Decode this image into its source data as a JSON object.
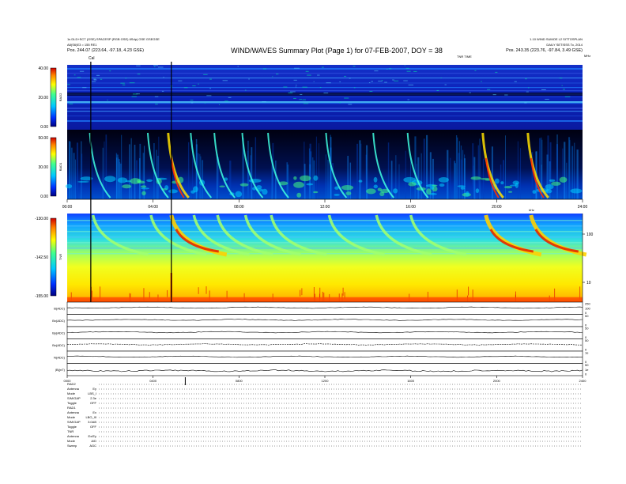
{
  "chart_data": {
    "type": "heatmap",
    "title": "WIND/WAVES Summary Plot (Page 1) for 07-FEB-2007, DOY = 38",
    "header_left": [
      "1s DLD+SCT (GSE) SPACESP (RGB GSE) 6Sdp)  GSE GSEGSE",
      "A8(S6)E3 = 155 RE1",
      "Pos.  244.07 (223.64, -97.18, 4.23 GSE)"
    ],
    "header_right": [
      "1.10 WIND SUMOE                    L2 SITTOSPLAN",
      "DAILY SETISSS To, 2014",
      "Pos.  243.35 (223.76, -97.84, 3.49 GSE)"
    ],
    "marker_labels": [
      "Cal",
      "TNR TIME"
    ],
    "time_ticks": [
      "00:00",
      "04:00",
      "08:00",
      "12:00",
      "16:00",
      "20:00",
      "24:00"
    ],
    "bottom_time_ticks": [
      "0000",
      "0400",
      "0800",
      "1200",
      "1600",
      "2000",
      "2400"
    ],
    "panels": [
      {
        "name": "RAD2",
        "ylim": [
          0,
          40
        ],
        "colorbar_ticks": [
          "40.00",
          "20.00",
          "0.00"
        ],
        "right_unit": "MHz"
      },
      {
        "name": "RAD1",
        "ylim": [
          0,
          50
        ],
        "colorbar_ticks": [
          "50.00",
          "30.00",
          "0.00"
        ],
        "right_unit": ""
      },
      {
        "name": "TNR",
        "ylim": [
          -155,
          -130
        ],
        "colorbar_ticks": [
          "-130.00",
          "-142.50",
          "-155.00"
        ],
        "right_ticks": [
          "100",
          "10"
        ],
        "right_unit": "kHz"
      }
    ],
    "bursts_hours": [
      1.2,
      3.9,
      4.85,
      5.9,
      7.0,
      8.3,
      9.5,
      12.2,
      14.4,
      16.0,
      19.5,
      21.6
    ],
    "strong_burst_hours": [
      4.85,
      19.5,
      21.6
    ],
    "gaps_hours": [
      1.1,
      4.85
    ],
    "line_panels": [
      {
        "label": "B(ADC)",
        "ticks": [
          "250",
          "100",
          "0"
        ]
      },
      {
        "label": "Bx(ADC)",
        "ticks": [
          "50",
          "0"
        ]
      },
      {
        "label": "By(ADC)",
        "ticks": [
          "50",
          "0"
        ]
      },
      {
        "label": "Bz(ADC)",
        "ticks": [
          "50",
          "0"
        ]
      },
      {
        "label": "N(ADC)",
        "ticks": [
          "1e",
          "0"
        ]
      },
      {
        "label": "|B|(nT)",
        "ticks": [
          "50",
          "1e",
          "0"
        ]
      }
    ],
    "instrument_table": [
      {
        "label": "RAD2",
        "value": ""
      },
      {
        "label": "Antenna",
        "value": "Ey"
      },
      {
        "label": "Mode",
        "value": "LBS_I"
      },
      {
        "label": "S/M/GAP",
        "value": "2.3e"
      },
      {
        "label": "Toggle",
        "value": "OFF"
      },
      {
        "label": "RAD1",
        "value": ""
      },
      {
        "label": "Antenna",
        "value": "Ex"
      },
      {
        "label": "Mode",
        "value": "LBO_III"
      },
      {
        "label": "S/M/GAP",
        "value": "3.0AB"
      },
      {
        "label": "Toggle",
        "value": "OFF"
      },
      {
        "label": "TNR",
        "value": ""
      },
      {
        "label": "Antenna",
        "value": "Ex/Ey"
      },
      {
        "label": "Mode",
        "value": "A/D"
      },
      {
        "label": "Sweep",
        "value": "AGC"
      }
    ],
    "colormap": "rainbow (blue-low, red-high)"
  }
}
